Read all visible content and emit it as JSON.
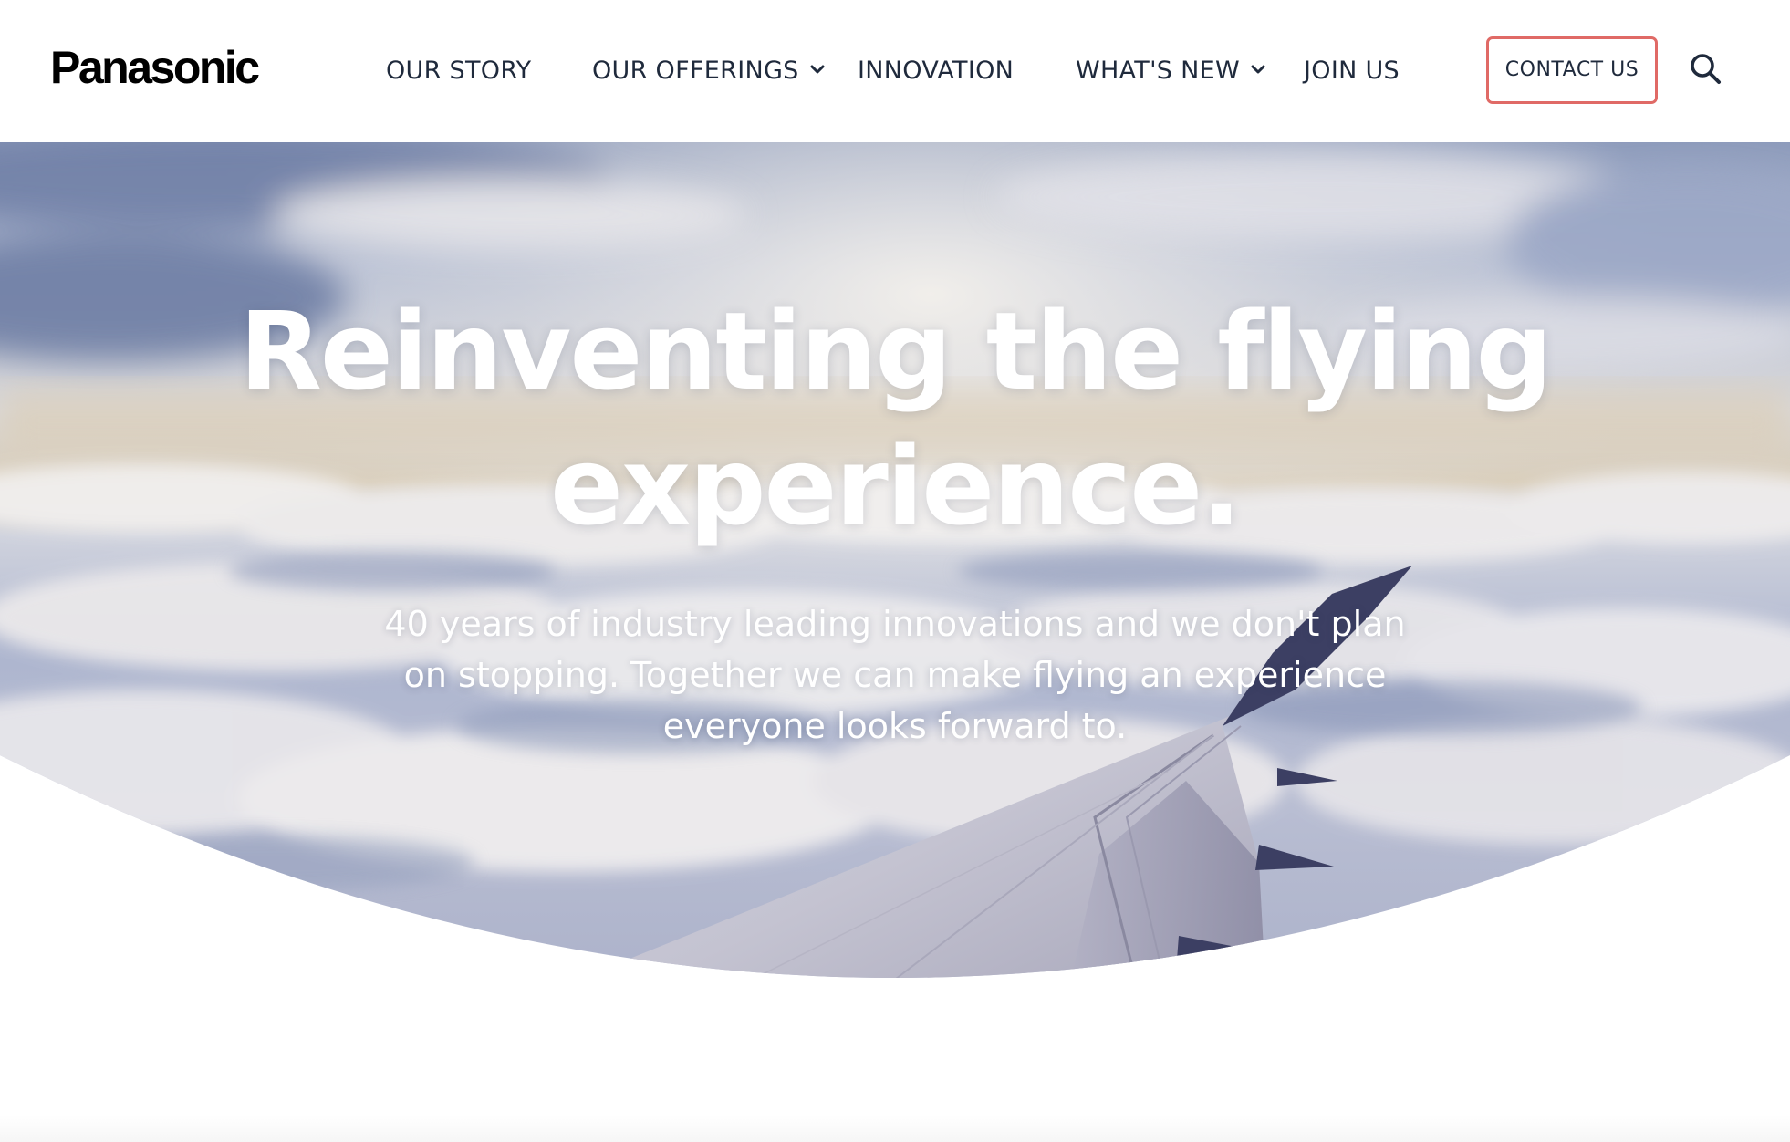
{
  "brand": {
    "logo_text": "Panasonic"
  },
  "nav": {
    "items": [
      {
        "label": "OUR STORY",
        "has_dropdown": false
      },
      {
        "label": "OUR OFFERINGS",
        "has_dropdown": true
      },
      {
        "label": "INNOVATION",
        "has_dropdown": false
      },
      {
        "label": "WHAT'S NEW",
        "has_dropdown": true
      },
      {
        "label": "JOIN US",
        "has_dropdown": false
      }
    ],
    "contact_label": "CONTACT US",
    "search_icon": "search-icon",
    "dropdown_icon": "chevron-down-icon"
  },
  "hero": {
    "title_line1": "Reinventing the flying",
    "title_line2": "experience.",
    "subtitle": "40 years of industry leading innovations and we don't plan on stopping. Together we can make flying an experience everyone looks forward to.",
    "image": "airplane-wing-above-clouds"
  },
  "colors": {
    "nav_text": "#1f2a3c",
    "contact_border": "#e06a66",
    "hero_text": "#ffffff",
    "background": "#ffffff"
  }
}
